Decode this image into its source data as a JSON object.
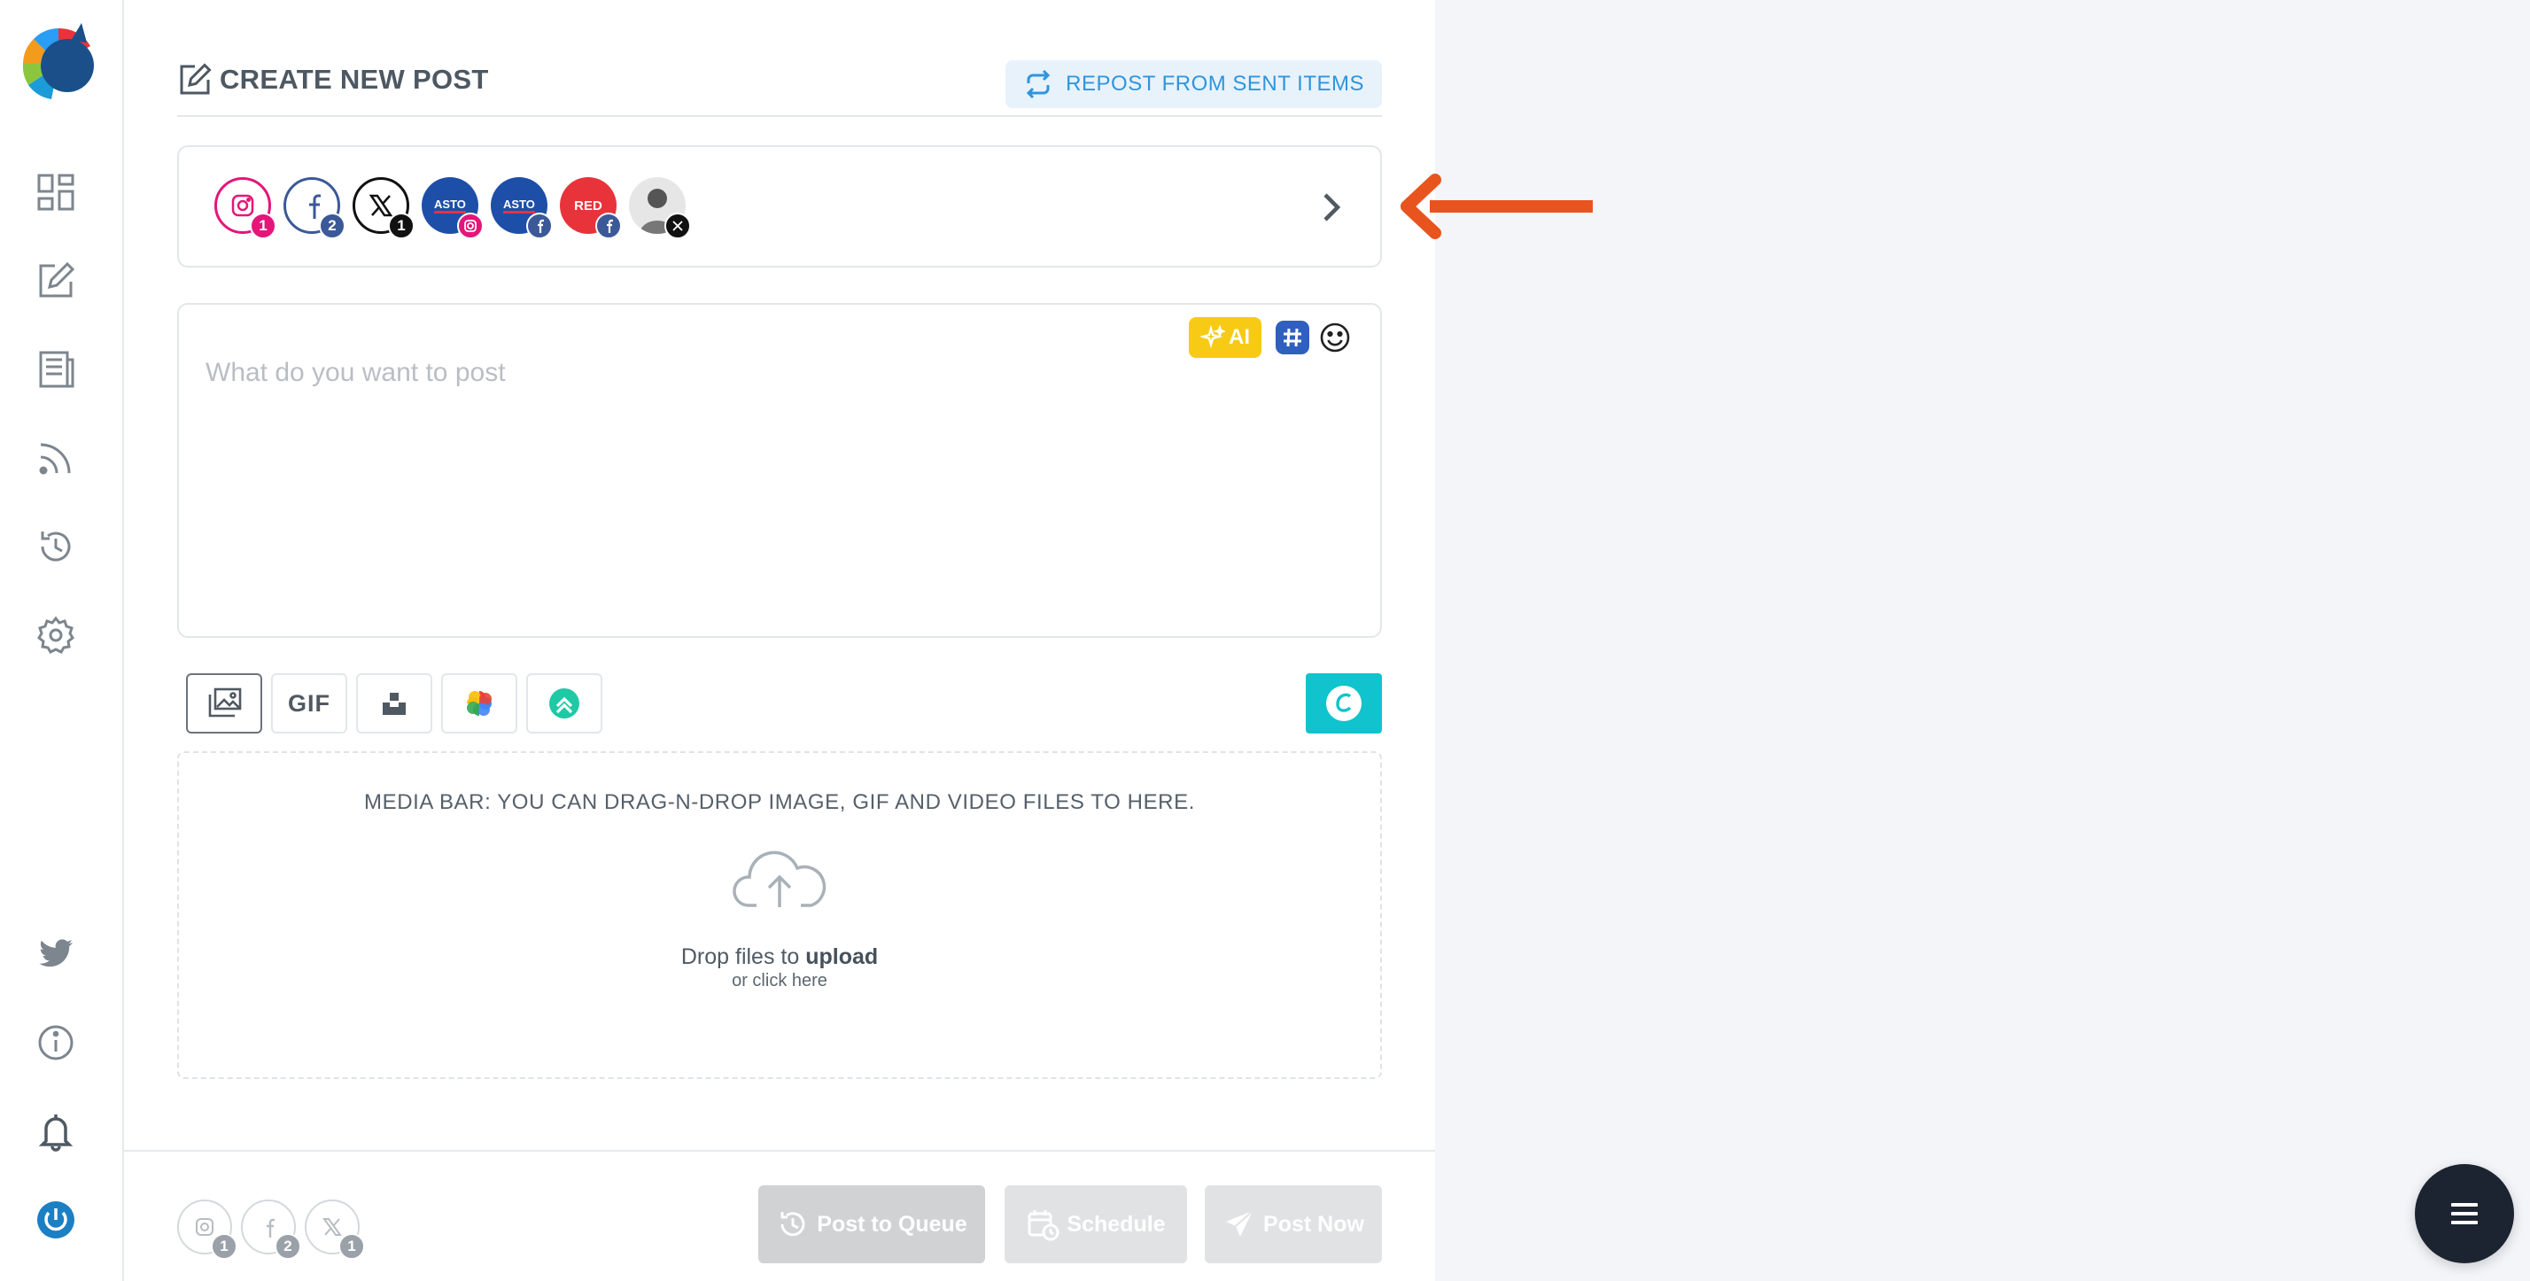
{
  "header": {
    "title": "CREATE NEW POST",
    "repost_label": "REPOST FROM SENT ITEMS"
  },
  "accounts": [
    {
      "network": "instagram",
      "badge": "1",
      "color": "#e4167a"
    },
    {
      "network": "facebook",
      "badge": "2",
      "color": "#3b5998"
    },
    {
      "network": "x",
      "badge": "1",
      "color": "#000000"
    },
    {
      "network": "asto-instagram",
      "label": "ASTO",
      "color": "#1d4fa8"
    },
    {
      "network": "asto-facebook",
      "label": "ASTO",
      "color": "#1d4fa8"
    },
    {
      "network": "red-facebook",
      "label": "RED",
      "color": "#e8333a"
    },
    {
      "network": "person-x",
      "color": "#d9d9d9"
    }
  ],
  "editor": {
    "placeholder": "What do you want to post",
    "ai_label": "AI"
  },
  "media": {
    "gif_label": "GIF",
    "dropzone_title": "MEDIA BAR: YOU CAN DRAG-N-DROP IMAGE, GIF AND VIDEO FILES TO HERE.",
    "drop_text": "Drop files to",
    "drop_bold": "upload",
    "click_text": "or click here"
  },
  "footer": {
    "counts": [
      {
        "network": "instagram",
        "count": "1"
      },
      {
        "network": "facebook",
        "count": "2"
      },
      {
        "network": "x",
        "count": "1"
      }
    ],
    "post_queue_label": "Post to Queue",
    "schedule_label": "Schedule",
    "post_now_label": "Post Now"
  },
  "colors": {
    "accent": "#2f95dc",
    "arrow": "#e8541e",
    "disabled_button": "#d2d4d6",
    "canva": "#11c3cc",
    "ai_yellow": "#f7cb15"
  }
}
